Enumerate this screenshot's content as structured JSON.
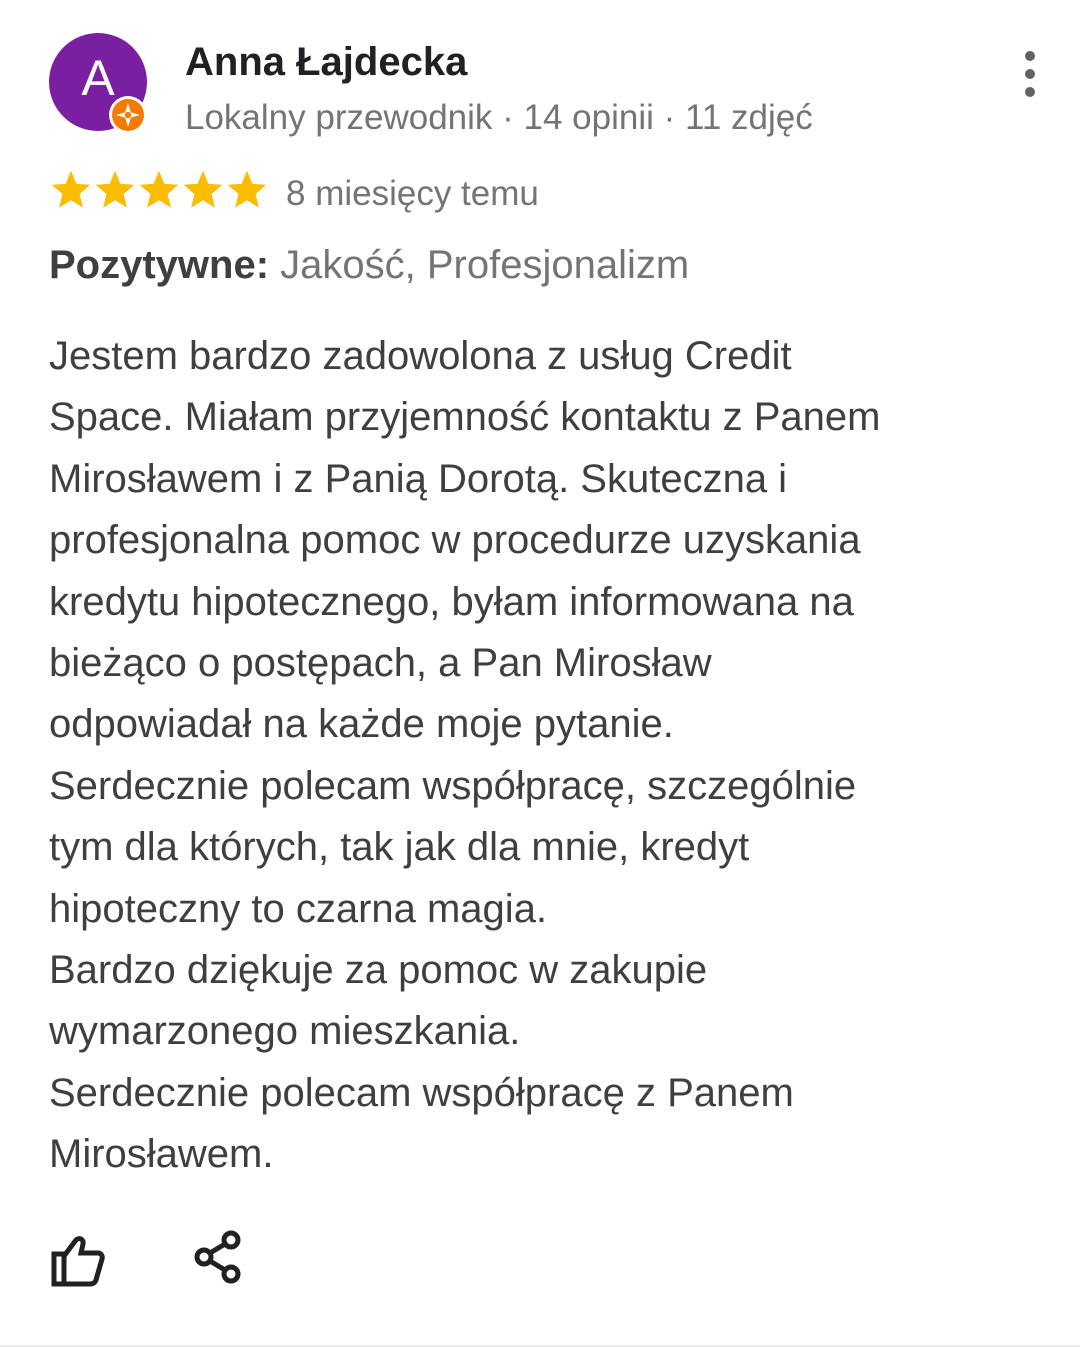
{
  "reviewer": {
    "avatar_letter": "A",
    "avatar_color": "#7b1fa2",
    "badge_color": "#f57c00",
    "name": "Anna Łajdecka",
    "meta": "Lokalny przewodnik · 14 opinii · 11 zdjęć"
  },
  "rating": {
    "stars": 5,
    "max_stars": 5,
    "star_color": "#fbbc04",
    "date": "8 miesięcy temu"
  },
  "positives": {
    "label": "Pozytywne:",
    "value": " Jakość, Profesjonalizm"
  },
  "review": {
    "lines": [
      "Jestem bardzo zadowolona z usług Credit",
      "Space. Miałam przyjemność kontaktu z Panem",
      "Mirosławem  i z Panią Dorotą. Skuteczna i",
      "profesjonalna pomoc w procedurze uzyskania",
      "kredytu hipotecznego, byłam informowana na",
      "bieżąco o postępach, a Pan Mirosław",
      "odpowiadał na każde moje pytanie.",
      "Serdecznie polecam współpracę, szczególnie",
      "tym dla których, tak jak dla mnie, kredyt",
      "hipoteczny to czarna magia.",
      "Bardzo dziękuje za pomoc w zakupie",
      "wymarzonego mieszkania.",
      "Serdecznie polecam współpracę z Panem",
      "Mirosławem."
    ]
  },
  "actions": {
    "like_icon": "thumb-up-icon",
    "share_icon": "share-icon",
    "more_icon": "more-vert-icon"
  }
}
